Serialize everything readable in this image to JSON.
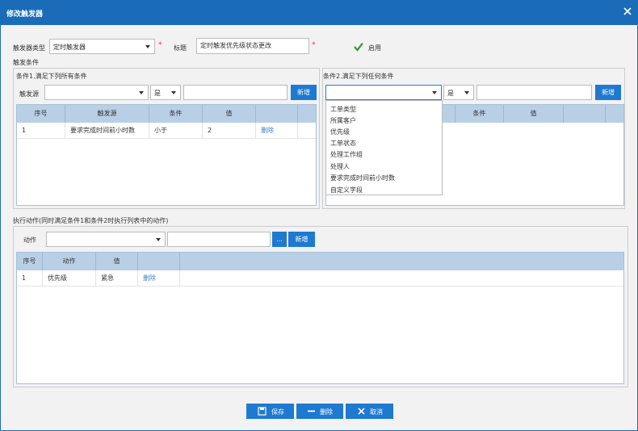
{
  "window": {
    "title": "修改触发器"
  },
  "form": {
    "trigger_type_label": "触发器类型",
    "trigger_type_value": "定时触发器",
    "title_label": "标题",
    "title_value": "定时触发优先级状态更改",
    "enabled_label": "启用",
    "enabled": true,
    "required_mark": "*"
  },
  "conditions": {
    "section_label": "触发条件",
    "cond1": {
      "label": "条件1.满足下列所有条件",
      "source_label": "触发源",
      "source_value": "",
      "op_value": "是",
      "input_value": "",
      "add_label": "新增",
      "columns": [
        "序号",
        "触发源",
        "条件",
        "值",
        "",
        ""
      ],
      "rows": [
        {
          "no": "1",
          "source": "要求完成时间前小时数",
          "cond": "小于",
          "value": "2",
          "action": "删除"
        }
      ]
    },
    "cond2": {
      "label": "条件2.满足下列任何条件",
      "source_value": "",
      "op_value": "是",
      "input_value": "",
      "add_label": "新增",
      "columns": [
        "条件",
        "值"
      ],
      "dropdown_options": [
        "工单类型",
        "所属客户",
        "优先级",
        "工单状态",
        "处理工作组",
        "处理人",
        "要求完成时间前小时数",
        "自定义字段"
      ]
    }
  },
  "actions": {
    "section_label": "执行动作(同时满足条件1和条件2时执行列表中的动作)",
    "action_label": "动作",
    "action_value": "",
    "input_value": "",
    "ellipsis_label": "...",
    "add_label": "新增",
    "columns": [
      "序号",
      "动作",
      "值",
      ""
    ],
    "rows": [
      {
        "no": "1",
        "action": "优先级",
        "value": "紧急",
        "op": "删除"
      }
    ]
  },
  "footer": {
    "save_label": "保存",
    "delete_label": "删除",
    "cancel_label": "取消"
  },
  "colors": {
    "accent": "#1e7ad1",
    "titlebar": "#1a6cb8",
    "grid_header": "#b9cfe6",
    "link": "#3e7fc4",
    "required": "#e33333"
  }
}
